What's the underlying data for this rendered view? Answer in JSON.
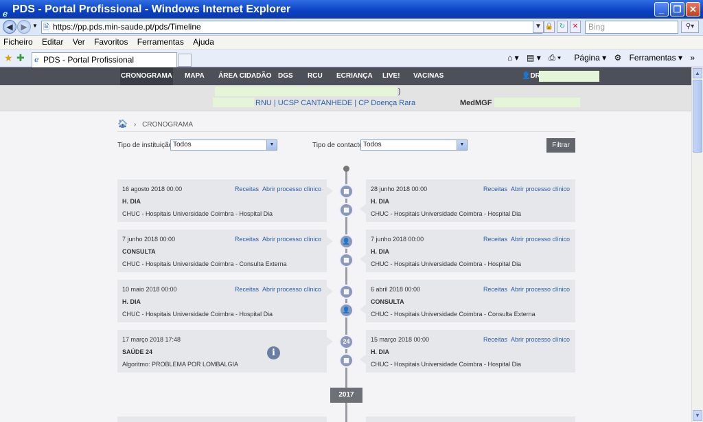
{
  "window": {
    "title": "PDS - Portal Profissional - Windows Internet Explorer",
    "ie_icon": "ie-logo-icon"
  },
  "address": {
    "url": "https://pp.pds.min-saude.pt/pds/Timeline",
    "search_placeholder": "Bing"
  },
  "menu": [
    "Ficheiro",
    "Editar",
    "Ver",
    "Favoritos",
    "Ferramentas",
    "Ajuda"
  ],
  "tab": {
    "title": "PDS - Portal Profissional"
  },
  "commandbar": {
    "page": "Página",
    "tools": "Ferramentas"
  },
  "sitenav": {
    "items": [
      "CRONOGRAMA",
      "MAPA",
      "ÁREA CIDADÃO",
      "DGS",
      "RCU",
      "ECRIANÇA",
      "LIVE!",
      "VACINAS"
    ],
    "active": "CRONOGRAMA",
    "user_label": "DR."
  },
  "patient": {
    "paren": ")",
    "links": "RNU | UCSP CANTANHEDE | CP Doença Rara",
    "tag": "MedMGF"
  },
  "breadcrumb": {
    "current": "CRONOGRAMA"
  },
  "filters": {
    "institution_label": "Tipo de instituição",
    "institution_value": "Todos",
    "contact_label": "Tipo de contacto",
    "contact_value": "Todos",
    "button": "Filtrar"
  },
  "timeline": {
    "link_receitas": "Receitas",
    "link_abrir": "Abrir processo clínico",
    "left": [
      {
        "date": "16 agosto 2018 00:00",
        "type": "H. DIA",
        "institution": "CHUC - Hospitais Universidade Coimbra - Hospital Dia",
        "actions": true
      },
      {
        "date": "7 junho 2018 00:00",
        "type": "CONSULTA",
        "institution": "CHUC - Hospitais Universidade Coimbra - Consulta Externa",
        "actions": true
      },
      {
        "date": "10 maio 2018 00:00",
        "type": "H. DIA",
        "institution": "CHUC - Hospitais Universidade Coimbra - Hospital Dia",
        "actions": true
      },
      {
        "date": "17 março 2018 17:48",
        "type": "SAÚDE 24",
        "institution": "Algoritmo: PROBLEMA POR LOMBALGIA",
        "actions": false
      }
    ],
    "right": [
      {
        "date": "28 junho 2018 00:00",
        "type": "H. DIA",
        "institution": "CHUC - Hospitais Universidade Coimbra - Hospital Dia",
        "actions": true
      },
      {
        "date": "7 junho 2018 00:00",
        "type": "H. DIA",
        "institution": "CHUC - Hospitais Universidade Coimbra - Hospital Dia",
        "actions": true
      },
      {
        "date": "6 abril 2018 00:00",
        "type": "CONSULTA",
        "institution": "CHUC - Hospitais Universidade Coimbra - Consulta Externa",
        "actions": true
      },
      {
        "date": "15 março 2018 00:00",
        "type": "H. DIA",
        "institution": "CHUC - Hospitais Universidade Coimbra - Hospital Dia",
        "actions": true
      }
    ],
    "saude24_badge": "24",
    "year": "2017"
  }
}
